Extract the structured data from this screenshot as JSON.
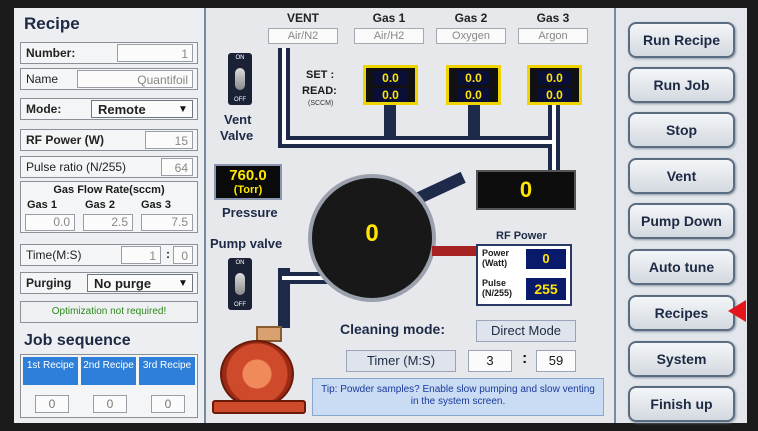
{
  "recipe": {
    "title": "Recipe",
    "number_label": "Number:",
    "number_value": "1",
    "name_label": "Name",
    "name_value": "Quantifoil",
    "mode_label": "Mode:",
    "mode_value": "Remote",
    "rf_power_label": "RF Power (W)",
    "rf_power_value": "15",
    "pulse_ratio_label": "Pulse ratio (N/255)",
    "pulse_ratio_value": "64",
    "gas_flow_title": "Gas Flow Rate(sccm)",
    "gas_labels": [
      "Gas 1",
      "Gas 2",
      "Gas 3"
    ],
    "gas_values": [
      "0.0",
      "2.5",
      "7.5"
    ],
    "time_label": "Time(M:S)",
    "time_min": "1",
    "time_sep": ":",
    "time_sec": "0",
    "purging_label": "Purging",
    "purging_value": "No purge",
    "optimization_note": "Optimization not required!"
  },
  "job_sequence": {
    "title": "Job sequence",
    "headers": [
      "1st Recipe",
      "2nd Recipe",
      "3rd Recipe"
    ],
    "values": [
      "0",
      "0",
      "0"
    ]
  },
  "gases": {
    "columns": [
      {
        "header": "VENT",
        "name": "Air/N2"
      },
      {
        "header": "Gas 1",
        "name": "Air/H2"
      },
      {
        "header": "Gas 2",
        "name": "Oxygen"
      },
      {
        "header": "Gas 3",
        "name": "Argon"
      }
    ],
    "set_label": "SET :",
    "read_label": "READ:",
    "unit_label": "(SCCM)",
    "set_values": [
      "0.0",
      "0.0",
      "0.0"
    ],
    "read_values": [
      "0.0",
      "0.0",
      "0.0"
    ]
  },
  "vent_valve": {
    "label_1": "Vent",
    "label_2": "Valve",
    "on": "ON",
    "off": "OFF"
  },
  "pump_valve": {
    "label": "Pump valve",
    "on": "ON",
    "off": "OFF"
  },
  "pressure": {
    "value": "760.0",
    "unit": "(Torr)",
    "label": "Pressure"
  },
  "chamber": {
    "value": "0"
  },
  "gauge_value": "0",
  "rf_power": {
    "title": "RF Power",
    "power_label": "Power (Watt)",
    "power_value": "0",
    "pulse_label": "Pulse (N/255)",
    "pulse_value": "255"
  },
  "cleaning_mode": {
    "label": "Cleaning mode:",
    "value": "Direct Mode"
  },
  "timer": {
    "label": "Timer (M:S)",
    "min": "3",
    "sep": ":",
    "sec": "59"
  },
  "tip": "Tip: Powder samples? Enable slow pumping and slow venting in the system screen.",
  "buttons": [
    "Run Recipe",
    "Run Job",
    "Stop",
    "Vent",
    "Pump Down",
    "Auto tune",
    "Recipes",
    "System",
    "Finish up"
  ],
  "colors": {
    "accent_blue": "#2e7fd9",
    "display_yellow": "#ffe600",
    "pipe_dark": "#1e2a4a",
    "indicator_red": "#e3151a"
  }
}
